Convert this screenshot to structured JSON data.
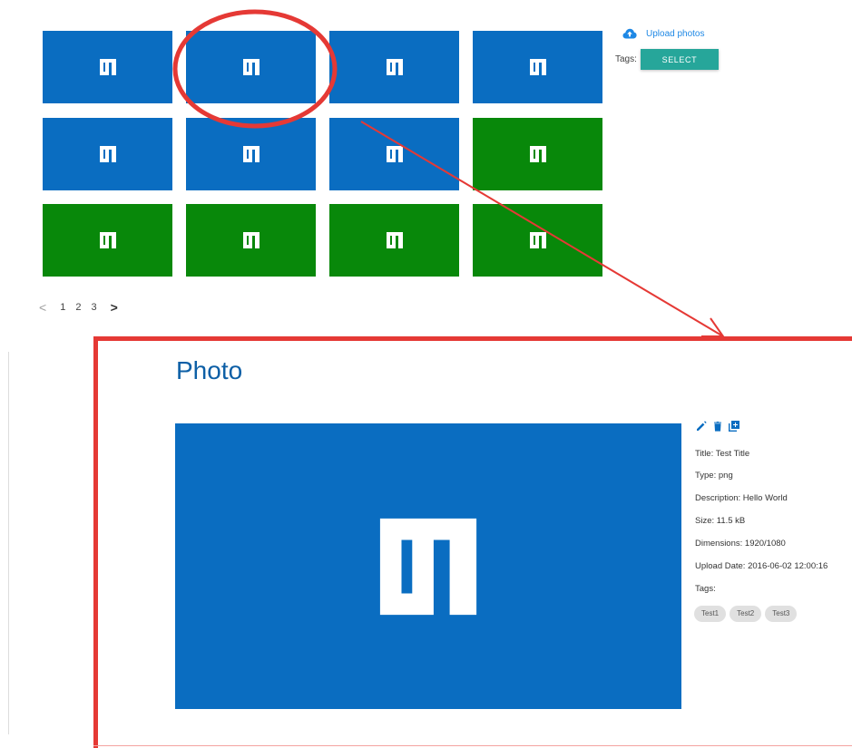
{
  "colors": {
    "tile_blue": "#0a6dc1",
    "tile_green": "#08880a",
    "accent_teal": "#26a69a",
    "link_blue": "#1e88e5",
    "annotation_red": "#e53935",
    "title_blue": "#0d5fa6"
  },
  "gallery": {
    "tiles": [
      {
        "color": "blue",
        "icon": "logo-icon"
      },
      {
        "color": "blue",
        "icon": "logo-icon"
      },
      {
        "color": "blue",
        "icon": "logo-icon"
      },
      {
        "color": "blue",
        "icon": "logo-icon"
      },
      {
        "color": "blue",
        "icon": "logo-icon"
      },
      {
        "color": "blue",
        "icon": "logo-icon"
      },
      {
        "color": "blue",
        "icon": "logo-icon"
      },
      {
        "color": "green",
        "icon": "logo-icon"
      },
      {
        "color": "green",
        "icon": "logo-icon"
      },
      {
        "color": "green",
        "icon": "logo-icon"
      },
      {
        "color": "green",
        "icon": "logo-icon"
      },
      {
        "color": "green",
        "icon": "logo-icon"
      }
    ],
    "highlighted_tile": 2
  },
  "sidebar": {
    "upload_icon": "cloud-upload-icon",
    "upload_label": "Upload photos",
    "tags_label": "Tags:",
    "select_label": "SELECT"
  },
  "pagination": {
    "prev": "<",
    "pages": [
      "1",
      "2",
      "3"
    ],
    "next": ">"
  },
  "detail": {
    "title": "Photo",
    "actions": [
      "edit-icon",
      "delete-icon",
      "add-box-icon"
    ],
    "fields": {
      "title": "Title: Test Title",
      "type": "Type: png",
      "description": "Description: Hello World",
      "size": "Size: 11.5 kB",
      "dimensions": "Dimensions: 1920/1080",
      "upload_date": "Upload Date: 2016-06-02 12:00:16",
      "tags_label": "Tags:"
    },
    "tags": [
      "Test1",
      "Test2",
      "Test3"
    ]
  }
}
